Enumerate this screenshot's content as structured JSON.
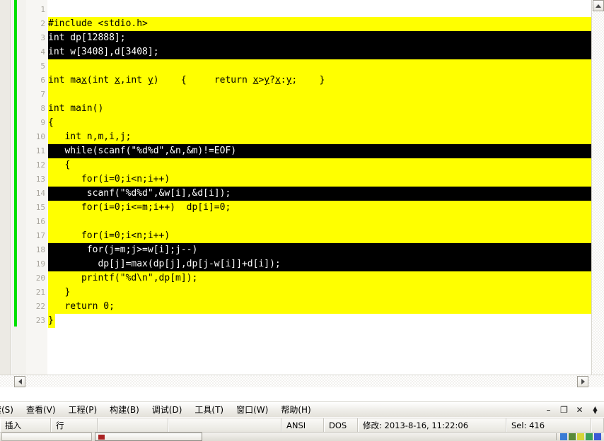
{
  "editor": {
    "lines": [
      {
        "num": "1",
        "text": "",
        "style": "plain",
        "width": "short"
      },
      {
        "num": "2",
        "text": "#include <stdio.h>",
        "style": "yellow",
        "width": "full"
      },
      {
        "num": "3",
        "text": "int dp[12888];",
        "style": "black",
        "width": "full",
        "breakpoint": true
      },
      {
        "num": "4",
        "text": "int w[3408],d[3408];",
        "style": "black",
        "width": "full",
        "breakpoint": true
      },
      {
        "num": "5",
        "text": "",
        "style": "yellow",
        "width": "full"
      },
      {
        "num": "6",
        "text": "int max(int x,int y)    {     return x>y?x:y;    }",
        "style": "yellow",
        "width": "full",
        "underline": [
          "x",
          "y"
        ]
      },
      {
        "num": "7",
        "text": "",
        "style": "yellow",
        "width": "full"
      },
      {
        "num": "8",
        "text": "int main()",
        "style": "yellow",
        "width": "full"
      },
      {
        "num": "9",
        "text": "{",
        "style": "yellow",
        "width": "full"
      },
      {
        "num": "10",
        "text": "   int n,m,i,j;",
        "style": "yellow",
        "width": "full"
      },
      {
        "num": "11",
        "text": "   while(scanf(\"%d%d\",&n,&m)!=EOF)",
        "style": "black",
        "width": "full",
        "breakpoint": true
      },
      {
        "num": "12",
        "text": "   {",
        "style": "yellow",
        "width": "full"
      },
      {
        "num": "13",
        "text": "      for(i=0;i<n;i++)",
        "style": "yellow",
        "width": "full"
      },
      {
        "num": "14",
        "text": "       scanf(\"%d%d\",&w[i],&d[i]);",
        "style": "black",
        "width": "full",
        "breakpoint": true
      },
      {
        "num": "15",
        "text": "      for(i=0;i<=m;i++)  dp[i]=0;",
        "style": "yellow",
        "width": "full"
      },
      {
        "num": "16",
        "text": "",
        "style": "yellow",
        "width": "full"
      },
      {
        "num": "17",
        "text": "      for(i=0;i<n;i++)",
        "style": "yellow",
        "width": "full"
      },
      {
        "num": "18",
        "text": "       for(j=m;j>=w[i];j--)",
        "style": "black",
        "width": "full",
        "breakpoint": true
      },
      {
        "num": "19",
        "text": "         dp[j]=max(dp[j],dp[j-w[i]]+d[i]);",
        "style": "black",
        "width": "full",
        "breakpoint": true
      },
      {
        "num": "20",
        "text": "      printf(\"%d\\n\",dp[m]);",
        "style": "yellow",
        "width": "full"
      },
      {
        "num": "21",
        "text": "   }",
        "style": "yellow",
        "width": "full"
      },
      {
        "num": "22",
        "text": "   return 0;",
        "style": "yellow",
        "width": "full"
      },
      {
        "num": "23",
        "text": "}",
        "style": "yellow",
        "width": "short"
      }
    ],
    "colors": {
      "highlight_yellow": "#ffff00",
      "highlight_black": "#000000",
      "change_bar_green": "#00e000",
      "breakpoint_red": "#e01010",
      "line_number": "#a9a69e"
    }
  },
  "menubar": {
    "items": [
      {
        "label": "索(S)"
      },
      {
        "label": "查看(V)"
      },
      {
        "label": "工程(P)"
      },
      {
        "label": "构建(B)"
      },
      {
        "label": "调试(D)"
      },
      {
        "label": "工具(T)"
      },
      {
        "label": "窗口(W)"
      },
      {
        "label": "帮助(H)"
      }
    ],
    "window_controls": {
      "minimize": "–",
      "restore": "❐",
      "close": "✕"
    }
  },
  "statusbar": {
    "mode": "插入",
    "line_label": "行",
    "blank1": "",
    "blank2": "",
    "blank3": "",
    "encoding": "ANSI",
    "line_ending": "DOS",
    "modified": "修改: 2013-8-16, 11:22:06",
    "selection": "Sel: 416"
  },
  "taskbar": {
    "items": [
      {
        "label": ""
      },
      {
        "label": ""
      }
    ]
  },
  "scrollbars": {
    "vertical_up": "▲",
    "horizontal_left": "◀",
    "horizontal_right": "▶"
  }
}
